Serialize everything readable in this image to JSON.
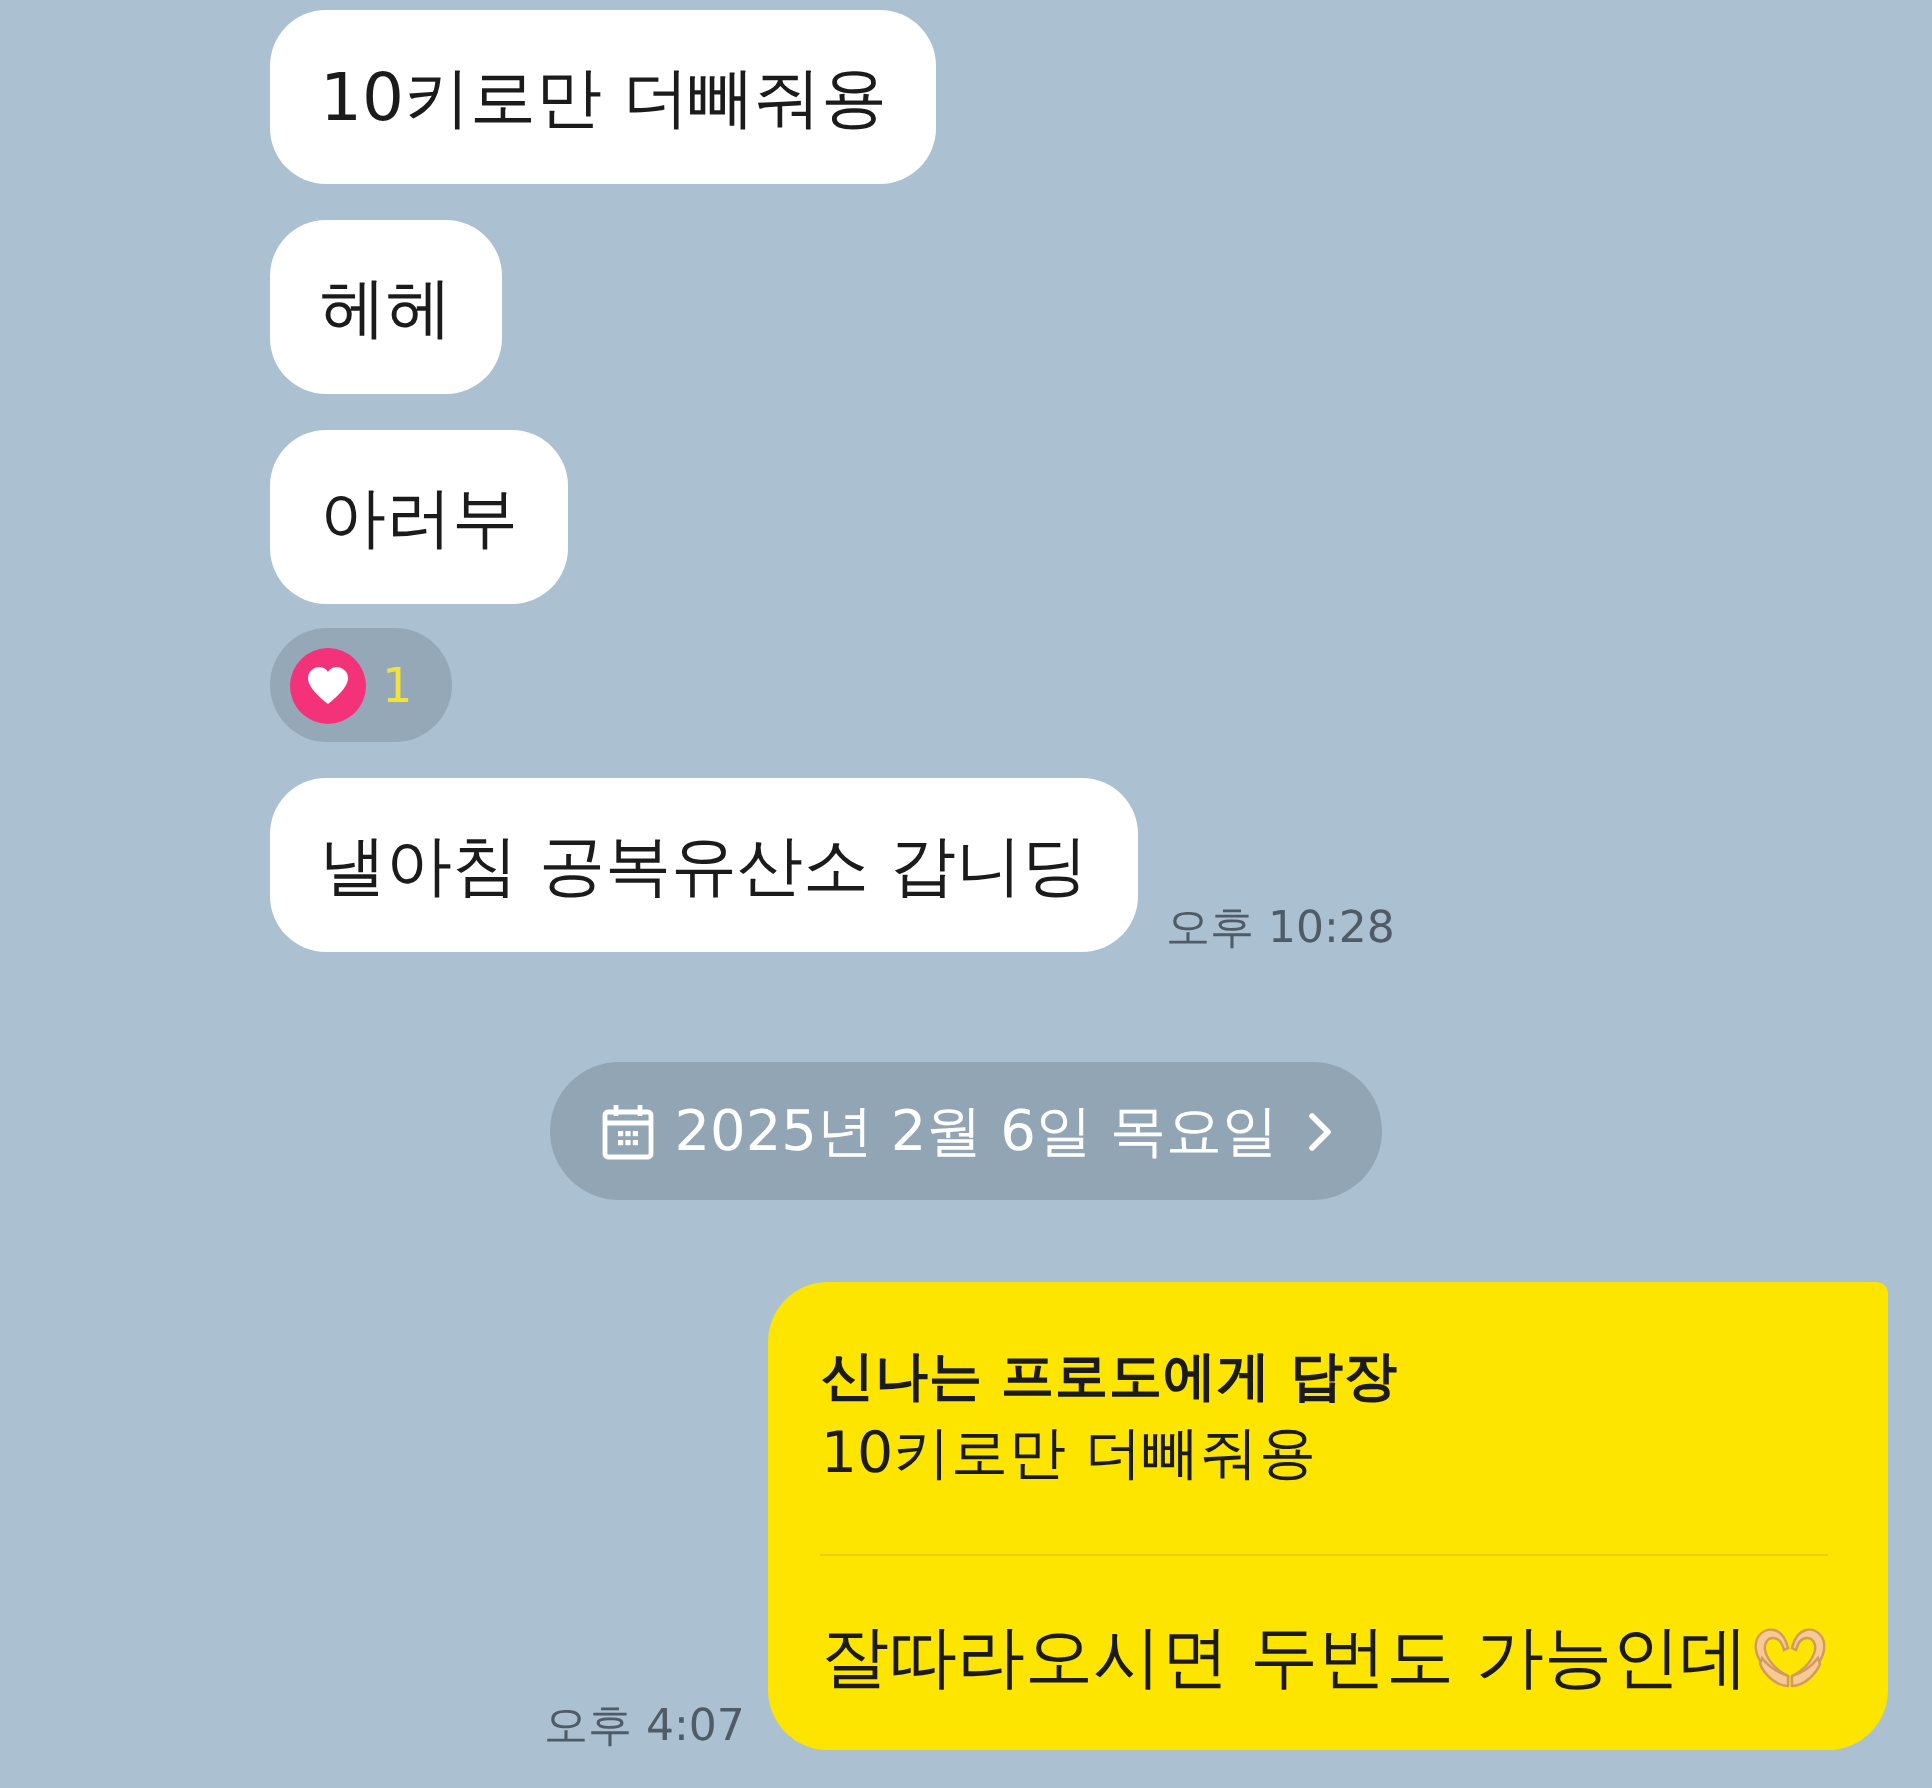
{
  "messages": [
    {
      "kind": "received",
      "text": "10키로만 더빼줘용"
    },
    {
      "kind": "received",
      "text": "헤헤"
    },
    {
      "kind": "received",
      "text": "아러부",
      "reaction": {
        "count": "1"
      }
    },
    {
      "kind": "received",
      "text": "낼아침 공복유산소 갑니딩",
      "time": "오후 10:28"
    },
    {
      "kind": "date",
      "text": "2025년 2월 6일 목요일"
    },
    {
      "kind": "sent",
      "reply_to": "신나는 프로도에게 답장",
      "quoted": "10키로만 더빼줘용",
      "text": "잘따라오시면 두번도 가능인데",
      "emoji": true,
      "time": "오후 4:07"
    }
  ]
}
